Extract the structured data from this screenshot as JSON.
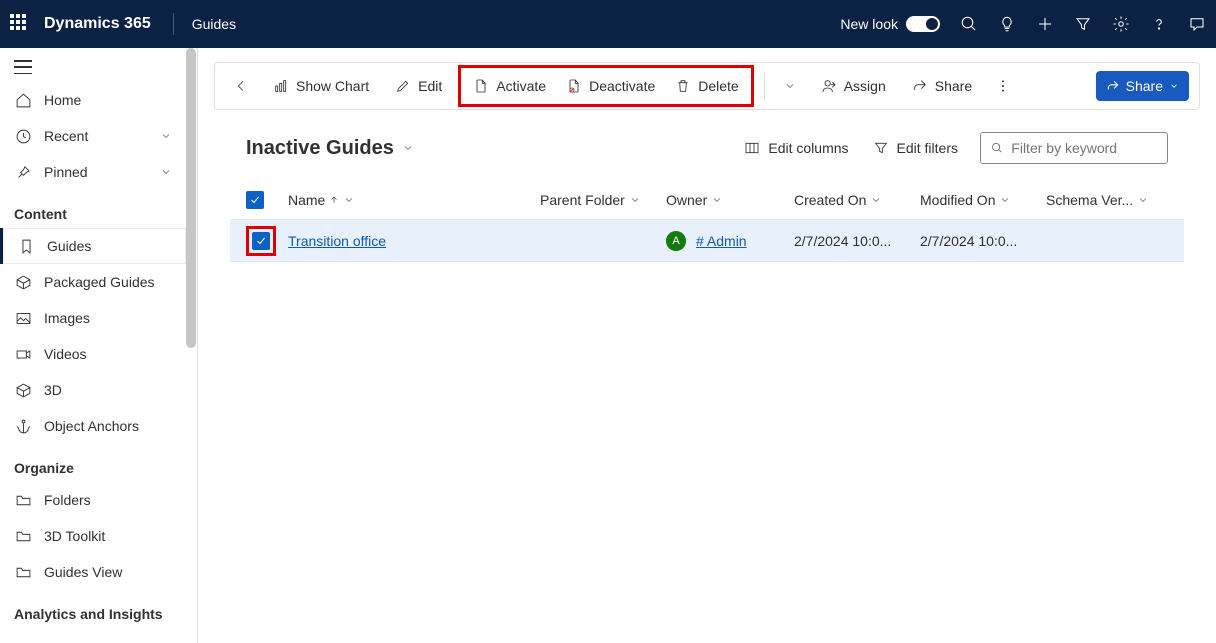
{
  "header": {
    "brand": "Dynamics 365",
    "module": "Guides",
    "new_look_label": "New look"
  },
  "sidebar": {
    "home": "Home",
    "recent": "Recent",
    "pinned": "Pinned",
    "section_content": "Content",
    "guides": "Guides",
    "packaged": "Packaged Guides",
    "images": "Images",
    "videos": "Videos",
    "three_d": "3D",
    "anchors": "Object Anchors",
    "section_organize": "Organize",
    "folders": "Folders",
    "toolkit": "3D Toolkit",
    "guides_view": "Guides View",
    "section_analytics": "Analytics and Insights"
  },
  "cmdbar": {
    "show_chart": "Show Chart",
    "edit": "Edit",
    "activate": "Activate",
    "deactivate": "Deactivate",
    "delete": "Delete",
    "assign": "Assign",
    "share": "Share",
    "share_primary": "Share"
  },
  "view": {
    "name": "Inactive Guides",
    "edit_columns": "Edit columns",
    "edit_filters": "Edit filters",
    "search_placeholder": "Filter by keyword"
  },
  "columns": {
    "name": "Name",
    "parent": "Parent Folder",
    "owner": "Owner",
    "created": "Created On",
    "modified": "Modified On",
    "schema": "Schema Ver..."
  },
  "rows": [
    {
      "name": "Transition office",
      "parent": "",
      "owner_initial": "A",
      "owner": "# Admin",
      "created": "2/7/2024 10:0...",
      "modified": "2/7/2024 10:0...",
      "schema": ""
    }
  ]
}
